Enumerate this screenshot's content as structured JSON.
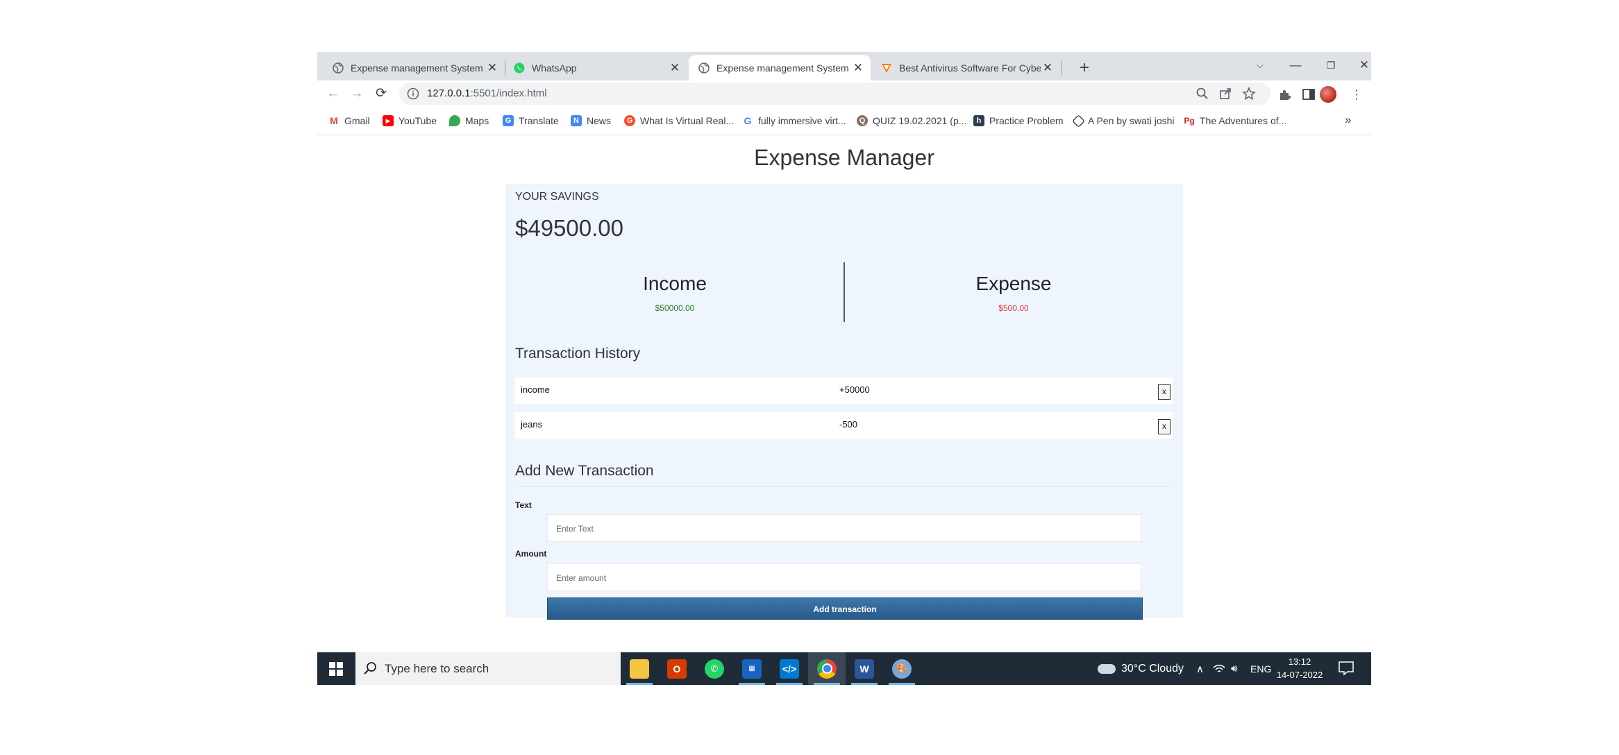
{
  "browser": {
    "tabs": [
      {
        "title": "Expense management System",
        "favicon": "globe-icon",
        "active": false
      },
      {
        "title": "WhatsApp",
        "favicon": "whatsapp-icon",
        "active": false
      },
      {
        "title": "Expense management System",
        "favicon": "globe-icon",
        "active": true
      },
      {
        "title": "Best Antivirus Software For Cybe",
        "favicon": "avast-icon",
        "active": false
      }
    ],
    "url_host": "127.0.0.1",
    "url_rest": ":5501/index.html",
    "bookmarks": [
      {
        "label": "Gmail",
        "icon": "gmail-icon",
        "color": "#ea4335"
      },
      {
        "label": "YouTube",
        "icon": "youtube-icon",
        "color": "#ff0000"
      },
      {
        "label": "Maps",
        "icon": "maps-icon",
        "color": "#34a853"
      },
      {
        "label": "Translate",
        "icon": "translate-icon",
        "color": "#4285f4"
      },
      {
        "label": "News",
        "icon": "news-icon",
        "color": "#4285f4"
      },
      {
        "label": "What Is Virtual Real...",
        "icon": "g2-icon",
        "color": "#ff492c"
      },
      {
        "label": "fully immersive virt...",
        "icon": "google-icon",
        "color": "#4285f4"
      },
      {
        "label": "QUIZ 19.02.2021 (p...",
        "icon": "quiz-icon",
        "color": "#8d6e63"
      },
      {
        "label": "Practice Problem",
        "icon": "hackerearth-icon",
        "color": "#2c3e50"
      },
      {
        "label": "A Pen by swati joshi",
        "icon": "codepen-icon",
        "color": "#000000"
      },
      {
        "label": "The Adventures of...",
        "icon": "book-icon",
        "color": "#c62828"
      }
    ]
  },
  "app": {
    "title": "Expense Manager",
    "savings_label": "YOUR SAVINGS",
    "savings_value": "$49500.00",
    "income_label": "Income",
    "income_value": "$50000.00",
    "expense_label": "Expense",
    "expense_value": "$500.00",
    "history_title": "Transaction History",
    "transactions": [
      {
        "text": "income",
        "amount": "+50000",
        "delete": "x"
      },
      {
        "text": "jeans",
        "amount": "-500",
        "delete": "x"
      }
    ],
    "add_title": "Add New Transaction",
    "text_label": "Text",
    "text_placeholder": "Enter Text",
    "amount_label": "Amount",
    "amount_placeholder": "Enter amount",
    "submit_label": "Add transaction",
    "colors": {
      "income": "#2e7d32",
      "expense": "#e53935",
      "button": "#2f6496"
    }
  },
  "taskbar": {
    "search_placeholder": "Type here to search",
    "weather": "30°C  Cloudy",
    "language": "ENG",
    "time": "13:12",
    "date": "14-07-2022",
    "apps": [
      "file-explorer-icon",
      "office-icon",
      "whatsapp-icon",
      "calendar-app-icon",
      "vscode-icon",
      "chrome-icon",
      "word-icon",
      "paint-icon"
    ]
  }
}
